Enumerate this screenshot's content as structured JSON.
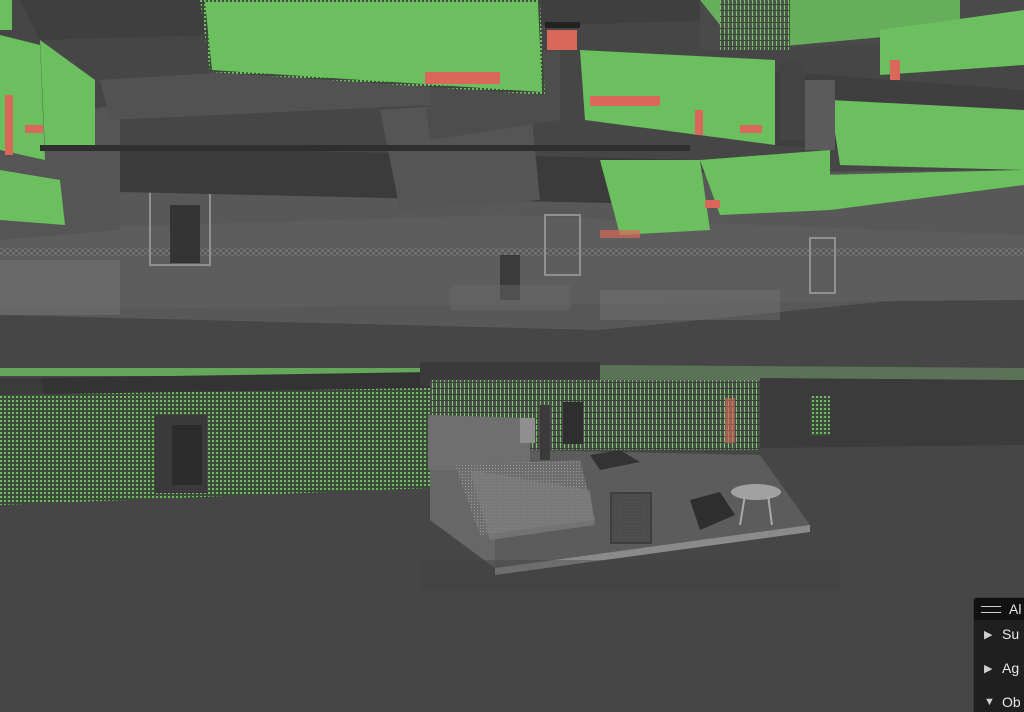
{
  "scene": {
    "background": "#464646",
    "colors": {
      "floor": "#4a4a4a",
      "slab_gray": "#5e5e5e",
      "slab_dark": "#3f3f3f",
      "highlight_green": "#6cbf5f",
      "highlight_red": "#d9685a",
      "ghost_white": "#bdbdbd"
    }
  },
  "panel": {
    "title": "Al",
    "handle_icon": "drag-handle-icon",
    "folders": [
      {
        "label": "Su",
        "state": "collapsed",
        "icon": "triangle-right-icon"
      },
      {
        "label": "Ag",
        "state": "collapsed",
        "icon": "triangle-right-icon"
      },
      {
        "label": "Ob",
        "state": "expanded",
        "icon": "triangle-down-icon"
      }
    ]
  }
}
